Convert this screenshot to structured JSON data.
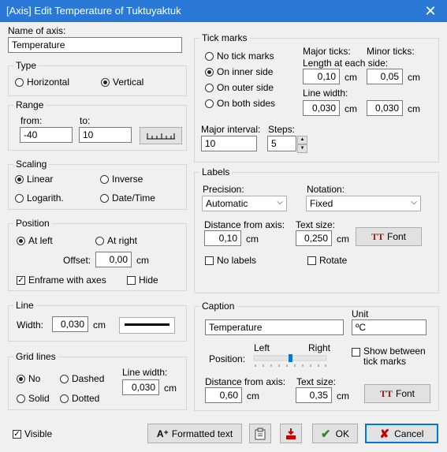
{
  "window": {
    "title": "[Axis] Edit Temperature of Tuktuyaktuk",
    "close_icon": "close-icon"
  },
  "name_of_axis": {
    "label": "Name of axis:",
    "value": "Temperature"
  },
  "type": {
    "title": "Type",
    "horizontal": "Horizontal",
    "vertical": "Vertical",
    "selected": "vertical"
  },
  "range": {
    "title": "Range",
    "from_label": "from:",
    "to_label": "to:",
    "from": "-40",
    "to": "10"
  },
  "scaling": {
    "title": "Scaling",
    "linear": "Linear",
    "inverse": "Inverse",
    "logarith": "Logarith.",
    "datetime": "Date/Time",
    "selected": "linear"
  },
  "position": {
    "title": "Position",
    "at_left": "At left",
    "at_right": "At right",
    "offset_label": "Offset:",
    "offset": "0,00",
    "unit": "cm",
    "enframe": "Enframe with axes",
    "hide": "Hide"
  },
  "line": {
    "title": "Line",
    "width_label": "Width:",
    "width": "0,030",
    "unit": "cm"
  },
  "grid_lines": {
    "title": "Grid lines",
    "no": "No",
    "dashed": "Dashed",
    "solid": "Solid",
    "dotted": "Dotted",
    "line_width_label": "Line width:",
    "line_width": "0,030",
    "unit": "cm"
  },
  "tick_marks": {
    "title": "Tick marks",
    "no_tick": "No tick marks",
    "inner": "On inner side",
    "outer": "On outer side",
    "both": "On both sides",
    "major_label": "Major ticks:",
    "minor_label": "Minor ticks:",
    "length_label": "Length at each side:",
    "major_length": "0,10",
    "minor_length": "0,05",
    "line_width_label": "Line width:",
    "major_width": "0,030",
    "minor_width": "0,030",
    "unit": "cm",
    "major_interval_label": "Major interval:",
    "major_interval": "10",
    "steps_label": "Steps:",
    "steps": "5"
  },
  "labels": {
    "title": "Labels",
    "precision_label": "Precision:",
    "precision": "Automatic",
    "notation_label": "Notation:",
    "notation": "Fixed",
    "distance_label": "Distance from axis:",
    "distance": "0,10",
    "text_size_label": "Text size:",
    "text_size": "0,250",
    "unit": "cm",
    "font_button": "Font",
    "no_labels": "No labels",
    "rotate": "Rotate"
  },
  "caption": {
    "title": "Caption",
    "value": "Temperature",
    "unit_label": "Unit",
    "unit_value": "ºC",
    "position_label": "Position:",
    "left": "Left",
    "right": "Right",
    "show_between": "Show between tick marks",
    "distance_label": "Distance from axis:",
    "distance": "0,60",
    "text_size_label": "Text size:",
    "text_size": "0,35",
    "unit": "cm",
    "font_button": "Font"
  },
  "footer": {
    "visible": "Visible",
    "formatted_text": "Formatted text",
    "ok": "OK",
    "cancel": "Cancel"
  }
}
